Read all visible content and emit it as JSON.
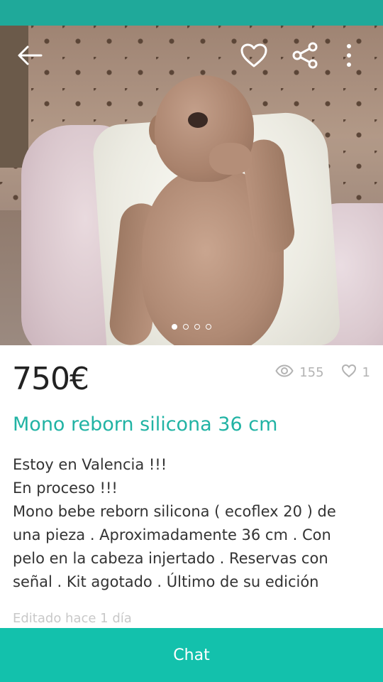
{
  "toolbar": {
    "icons": [
      "back-arrow-icon",
      "heart-icon",
      "share-icon",
      "more-vertical-icon"
    ]
  },
  "gallery": {
    "image_description_icon": "product-photo",
    "page_count": 4,
    "active_index": 0
  },
  "product": {
    "price": "750€",
    "views": "155",
    "likes": "1",
    "title": "Mono reborn silicona 36 cm",
    "description_lines": [
      "Estoy en Valencia !!!",
      "En proceso !!!",
      "Mono bebe reborn silicona ( ecoflex 20 ) de",
      "una pieza . Aproximadamente 36 cm . Con",
      "pelo en la cabeza injertado . Reservas con",
      "señal . Kit agotado . Último de su edición"
    ],
    "edited": "Editado hace 1 día"
  },
  "actions": {
    "chat_label": "Chat"
  },
  "colors": {
    "accent": "#13c1ac",
    "title": "#21b3a4",
    "status_bar": "#1fa99a"
  }
}
